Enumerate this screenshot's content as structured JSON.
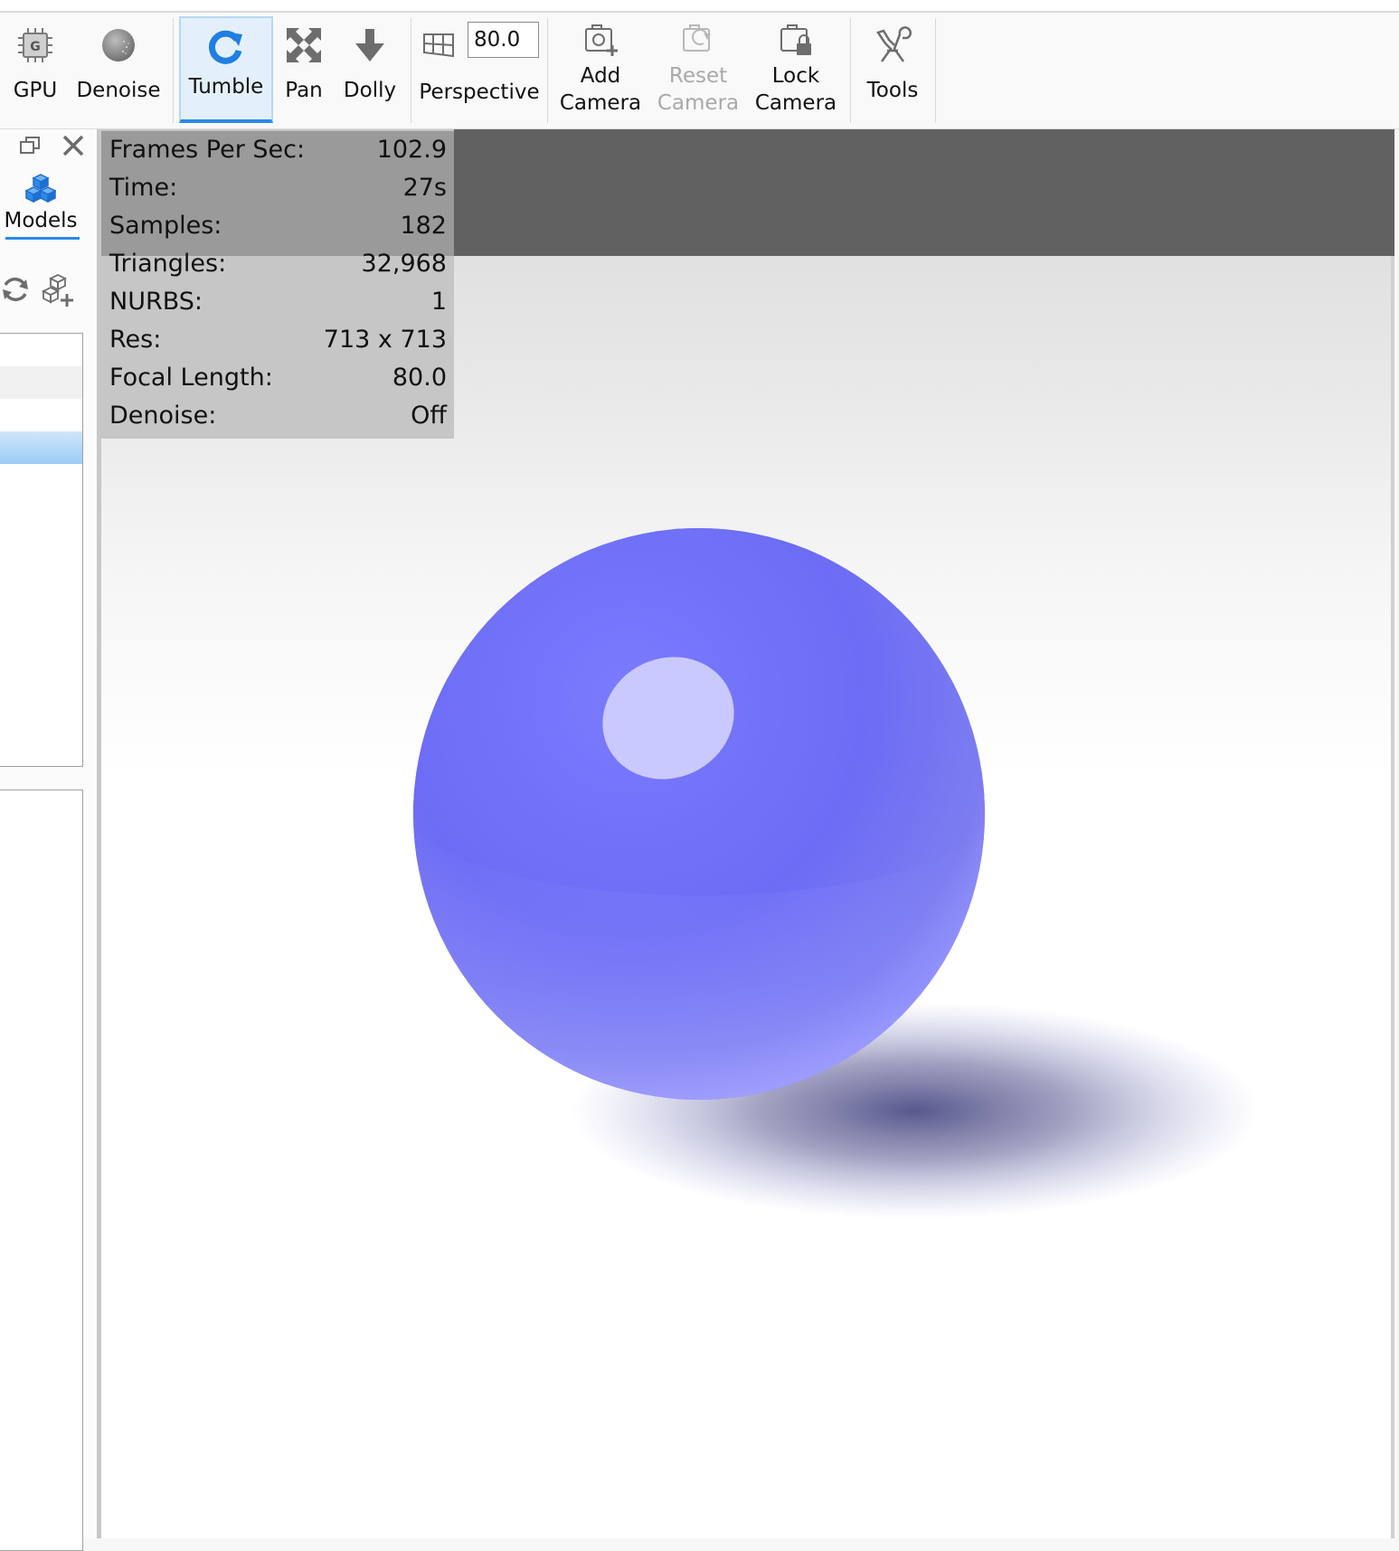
{
  "toolbar": {
    "gpu_label": "GPU",
    "denoise_label": "Denoise",
    "tumble_label": "Tumble",
    "pan_label": "Pan",
    "dolly_label": "Dolly",
    "perspective_label": "Perspective",
    "perspective_value": "80.0",
    "add_camera_line1": "Add",
    "add_camera_line2": "Camera",
    "reset_camera_line1": "Reset",
    "reset_camera_line2": "Camera",
    "lock_camera_line1": "Lock",
    "lock_camera_line2": "Camera",
    "tools_label": "Tools",
    "active_tool": "Tumble",
    "accent_color": "#2b8ae6"
  },
  "left_panel": {
    "models_tab_label": "Models",
    "selected_row_color": "#a8d1f7"
  },
  "stats": [
    {
      "key": "Frames Per Sec:",
      "value": "102.9"
    },
    {
      "key": "Time:",
      "value": "27s"
    },
    {
      "key": "Samples:",
      "value": "182"
    },
    {
      "key": "Triangles:",
      "value": "32,968"
    },
    {
      "key": "NURBS:",
      "value": "1"
    },
    {
      "key": "Res:",
      "value": "713 x 713"
    },
    {
      "key": "Focal Length:",
      "value": "80.0"
    },
    {
      "key": "Denoise:",
      "value": "Off"
    }
  ],
  "scene": {
    "sphere_color": "#6f6ff7",
    "highlight_color": "#c9c9ff"
  }
}
